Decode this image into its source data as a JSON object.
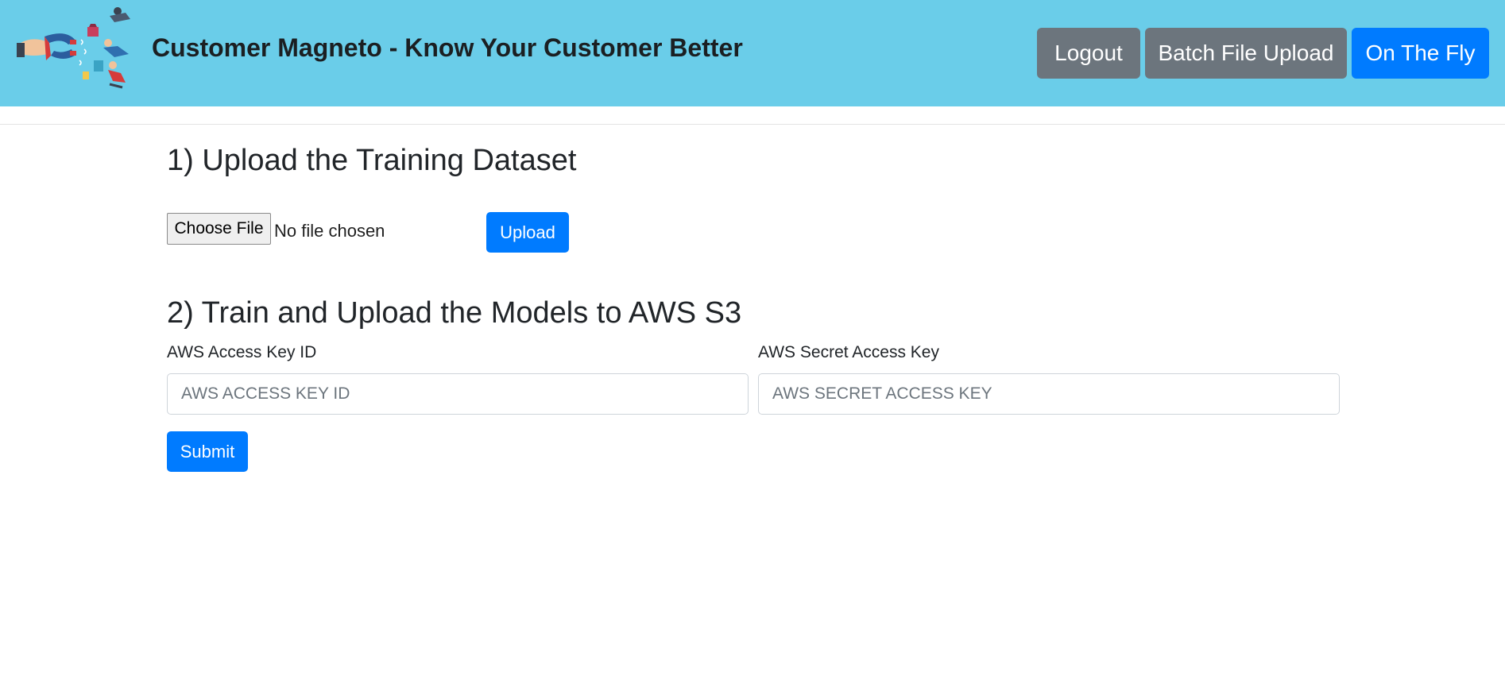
{
  "header": {
    "brand_title": "Customer Magneto - Know Your Customer Better",
    "logo_icon": "magnet-attracting-customers-icon",
    "nav": {
      "logout": "Logout",
      "batch_upload": "Batch File Upload",
      "on_the_fly": "On The Fly"
    }
  },
  "section1": {
    "heading": "1) Upload the Training Dataset",
    "choose_file": "Choose File",
    "file_status": "No file chosen",
    "upload_button": "Upload"
  },
  "section2": {
    "heading": "2) Train and Upload the Models to AWS S3",
    "access_key_label": "AWS Access Key ID",
    "access_key_placeholder": "AWS ACCESS KEY ID",
    "secret_key_label": "AWS Secret Access Key",
    "secret_key_placeholder": "AWS SECRET ACCESS KEY",
    "submit_button": "Submit"
  },
  "colors": {
    "navbar": "#6acde9",
    "primary": "#007bff",
    "secondary": "#6c757d"
  }
}
